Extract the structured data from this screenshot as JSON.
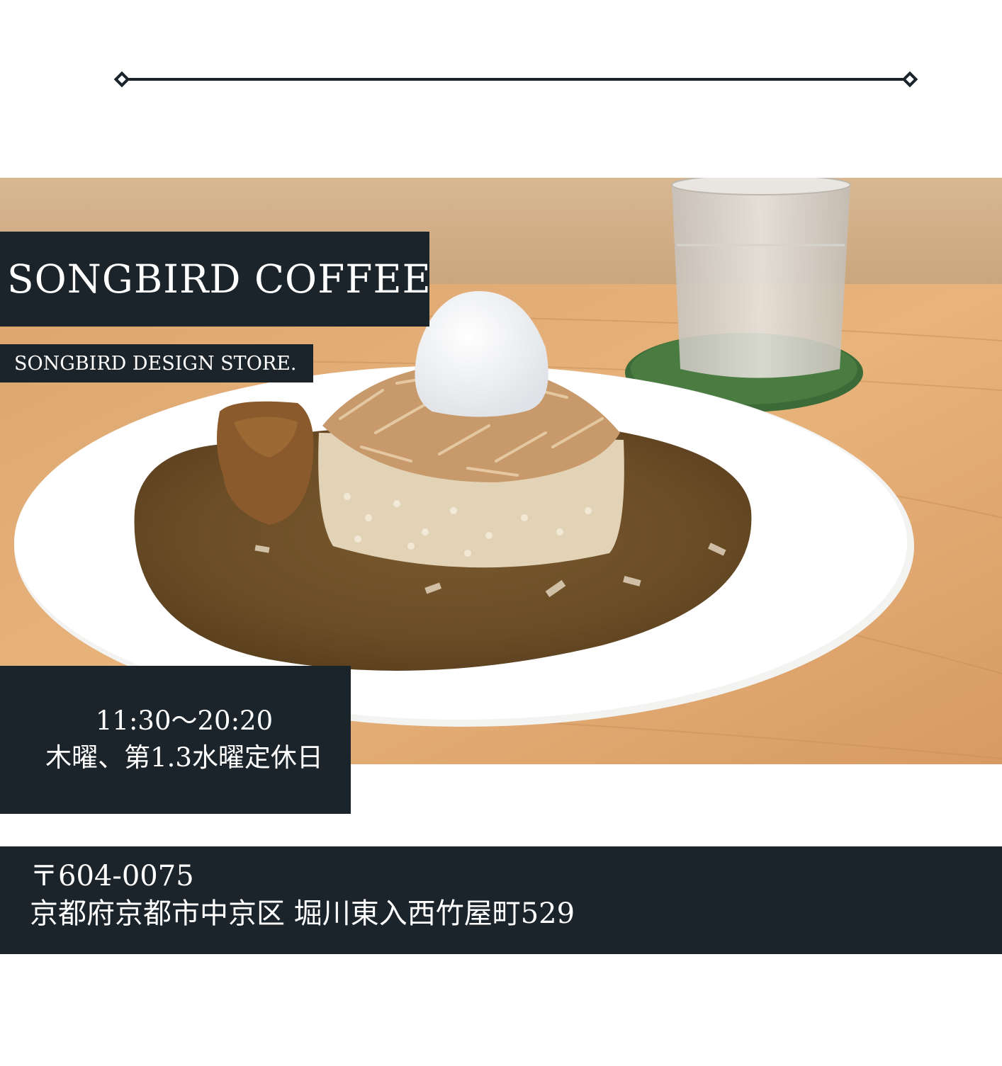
{
  "title": "SONGBIRD COFFEE",
  "subtitle": "SONGBIRD DESIGN STORE.",
  "hours": {
    "time": "11:30〜20:20",
    "closed": "木曜、第1.3水曜定休日"
  },
  "address": {
    "postal": "〒604-0075",
    "street": "京都府京都市中京区 堀川東入西竹屋町529"
  },
  "colors": {
    "panel": "#1b242b",
    "text": "#ffffff",
    "divider": "#1b242b"
  },
  "photo_subject": "curry-rice-plate-with-egg-and-water-glass"
}
